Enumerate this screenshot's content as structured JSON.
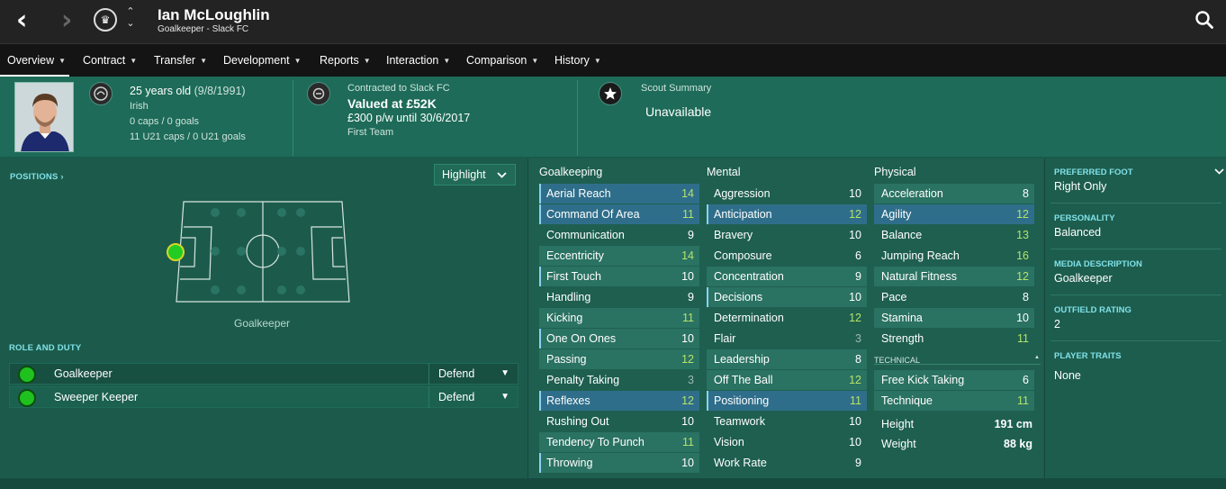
{
  "header": {
    "back_icon": "chevron-left-icon",
    "forward_icon": "chevron-right-icon",
    "badge_glyph": "♛",
    "player_name": "Ian McLoughlin",
    "subtitle": "Goalkeeper - Slack FC",
    "up": "⌃",
    "down": "⌄"
  },
  "tabs": [
    {
      "label": "Overview",
      "active": true
    },
    {
      "label": "Contract"
    },
    {
      "label": "Transfer"
    },
    {
      "label": "Development"
    },
    {
      "label": "Reports"
    },
    {
      "label": "Interaction"
    },
    {
      "label": "Comparison"
    },
    {
      "label": "History"
    }
  ],
  "info": {
    "age": "25 years old",
    "dob": "(9/8/1991)",
    "nationality": "Irish",
    "caps": "0 caps / 0 goals",
    "u21": "11 U21 caps / 0 U21 goals",
    "contract_label": "Contracted to Slack FC",
    "value": "Valued at £52K",
    "wage": "£300 p/w until 30/6/2017",
    "squad": "First Team",
    "scout_label": "Scout Summary",
    "scout_value": "Unavailable"
  },
  "positions": {
    "title": "POSITIONS",
    "arrow": "›",
    "highlight_label": "Highlight",
    "position_label": "Goalkeeper"
  },
  "roles": {
    "title": "ROLE AND DUTY",
    "items": [
      {
        "name": "Goalkeeper",
        "duty": "Defend"
      },
      {
        "name": "Sweeper Keeper",
        "duty": "Defend"
      }
    ]
  },
  "attributes": {
    "goalkeeping": {
      "title": "Goalkeeping",
      "items": [
        {
          "name": "Aerial Reach",
          "value": "14"
        },
        {
          "name": "Command Of Area",
          "value": "11"
        },
        {
          "name": "Communication",
          "value": "9"
        },
        {
          "name": "Eccentricity",
          "value": "14"
        },
        {
          "name": "First Touch",
          "value": "10"
        },
        {
          "name": "Handling",
          "value": "9"
        },
        {
          "name": "Kicking",
          "value": "11"
        },
        {
          "name": "One On Ones",
          "value": "10"
        },
        {
          "name": "Passing",
          "value": "12"
        },
        {
          "name": "Penalty Taking",
          "value": "3"
        },
        {
          "name": "Reflexes",
          "value": "12"
        },
        {
          "name": "Rushing Out",
          "value": "10"
        },
        {
          "name": "Tendency To Punch",
          "value": "11"
        },
        {
          "name": "Throwing",
          "value": "10"
        }
      ]
    },
    "mental": {
      "title": "Mental",
      "items": [
        {
          "name": "Aggression",
          "value": "10"
        },
        {
          "name": "Anticipation",
          "value": "12"
        },
        {
          "name": "Bravery",
          "value": "10"
        },
        {
          "name": "Composure",
          "value": "6"
        },
        {
          "name": "Concentration",
          "value": "9"
        },
        {
          "name": "Decisions",
          "value": "10"
        },
        {
          "name": "Determination",
          "value": "12"
        },
        {
          "name": "Flair",
          "value": "3"
        },
        {
          "name": "Leadership",
          "value": "8"
        },
        {
          "name": "Off The Ball",
          "value": "12"
        },
        {
          "name": "Positioning",
          "value": "11"
        },
        {
          "name": "Teamwork",
          "value": "10"
        },
        {
          "name": "Vision",
          "value": "10"
        },
        {
          "name": "Work Rate",
          "value": "9"
        }
      ]
    },
    "physical": {
      "title": "Physical",
      "items": [
        {
          "name": "Acceleration",
          "value": "8"
        },
        {
          "name": "Agility",
          "value": "12"
        },
        {
          "name": "Balance",
          "value": "13"
        },
        {
          "name": "Jumping Reach",
          "value": "16"
        },
        {
          "name": "Natural Fitness",
          "value": "12"
        },
        {
          "name": "Pace",
          "value": "8"
        },
        {
          "name": "Stamina",
          "value": "10"
        },
        {
          "name": "Strength",
          "value": "11"
        }
      ]
    },
    "technical": {
      "title": "TECHNICAL",
      "collapse_icon": "▲",
      "items": [
        {
          "name": "Free Kick Taking",
          "value": "6"
        },
        {
          "name": "Technique",
          "value": "11"
        }
      ]
    },
    "height_label": "Height",
    "height_value": "191 cm",
    "weight_label": "Weight",
    "weight_value": "88 kg"
  },
  "sidebar": {
    "foot_label": "PREFERRED FOOT",
    "foot_value": "Right Only",
    "personality_label": "PERSONALITY",
    "personality_value": "Balanced",
    "media_label": "MEDIA DESCRIPTION",
    "media_value": "Goalkeeper",
    "outfield_label": "OUTFIELD RATING",
    "outfield_value": "2",
    "traits_label": "PLAYER TRAITS",
    "traits_value": "None"
  },
  "colors": {
    "attr_white": "#ffffff",
    "attr_grey": "#9fb8b0",
    "attr_green": "#b5e36b",
    "accent_cyan": "#7fe1e8",
    "position_green": "#22cc22"
  }
}
